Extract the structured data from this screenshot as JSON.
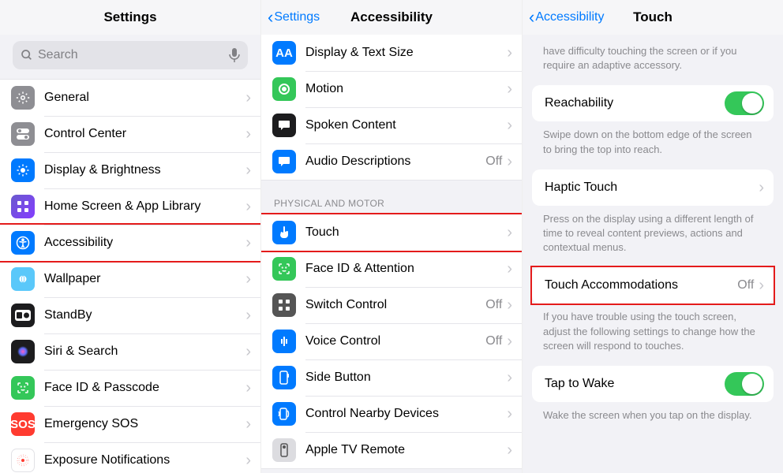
{
  "panel1": {
    "title": "Settings",
    "search_placeholder": "Search",
    "rows": [
      {
        "label": "General"
      },
      {
        "label": "Control Center"
      },
      {
        "label": "Display & Brightness"
      },
      {
        "label": "Home Screen & App Library"
      },
      {
        "label": "Accessibility"
      },
      {
        "label": "Wallpaper"
      },
      {
        "label": "StandBy"
      },
      {
        "label": "Siri & Search"
      },
      {
        "label": "Face ID & Passcode"
      },
      {
        "label": "Emergency SOS"
      },
      {
        "label": "Exposure Notifications"
      }
    ]
  },
  "panel2": {
    "back": "Settings",
    "title": "Accessibility",
    "rows_top": [
      {
        "label": "Display & Text Size"
      },
      {
        "label": "Motion"
      },
      {
        "label": "Spoken Content"
      },
      {
        "label": "Audio Descriptions",
        "status": "Off"
      }
    ],
    "section_header": "PHYSICAL AND MOTOR",
    "rows_motor": [
      {
        "label": "Touch"
      },
      {
        "label": "Face ID & Attention"
      },
      {
        "label": "Switch Control",
        "status": "Off"
      },
      {
        "label": "Voice Control",
        "status": "Off"
      },
      {
        "label": "Side Button"
      },
      {
        "label": "Control Nearby Devices"
      },
      {
        "label": "Apple TV Remote"
      }
    ]
  },
  "panel3": {
    "back": "Accessibility",
    "title": "Touch",
    "intro_note": "have difficulty touching the screen or if you require an adaptive accessory.",
    "reachability": {
      "label": "Reachability",
      "note": "Swipe down on the bottom edge of the screen to bring the top into reach."
    },
    "haptic": {
      "label": "Haptic Touch",
      "note": "Press on the display using a different length of time to reveal content previews, actions and contextual menus."
    },
    "accommodations": {
      "label": "Touch Accommodations",
      "status": "Off",
      "note": "If you have trouble using the touch screen, adjust the following settings to change how the screen will respond to touches."
    },
    "tap_to_wake": {
      "label": "Tap to Wake",
      "note": "Wake the screen when you tap on the display."
    }
  }
}
